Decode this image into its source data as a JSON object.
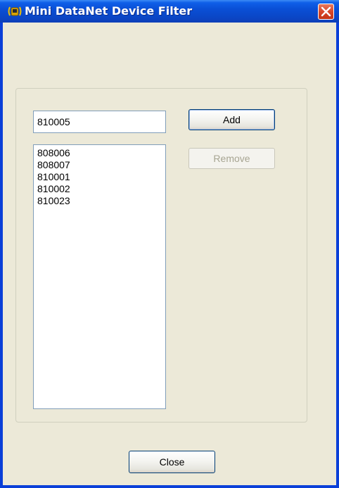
{
  "window": {
    "title": "Mini DataNet Device Filter"
  },
  "filter": {
    "input_value": "810005",
    "add_label": "Add",
    "remove_label": "Remove",
    "items": [
      "808006",
      "808007",
      "810001",
      "810002",
      "810023"
    ]
  },
  "footer": {
    "close_label": "Close"
  },
  "colors": {
    "titlebar": "#0a4fd6",
    "face": "#ece9d8",
    "close_button": "#d8472a"
  },
  "icons": {
    "app": "antenna-icon",
    "close": "close-icon"
  }
}
